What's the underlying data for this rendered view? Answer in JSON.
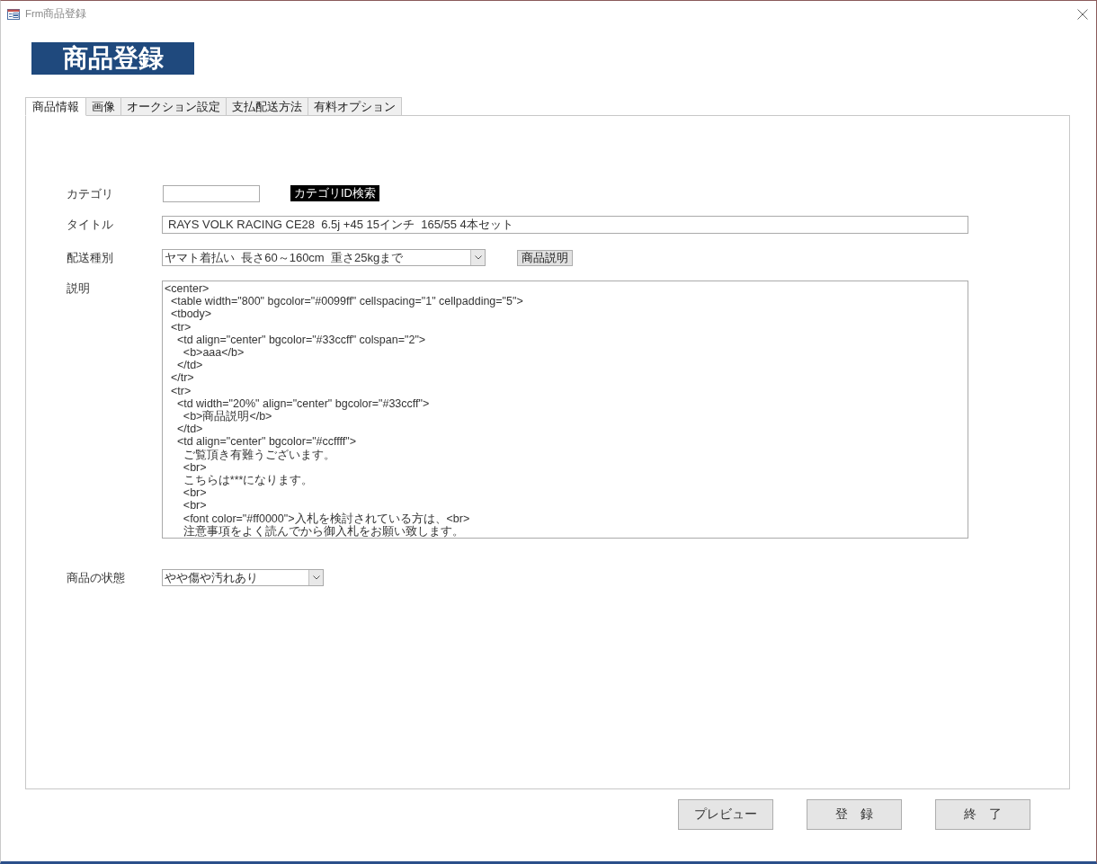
{
  "window": {
    "title": "Frm商品登録"
  },
  "header": {
    "title": "商品登録"
  },
  "tabs": [
    {
      "label": "商品情報",
      "selected": true
    },
    {
      "label": "画像",
      "selected": false
    },
    {
      "label": "オークション設定",
      "selected": false
    },
    {
      "label": "支払配送方法",
      "selected": false
    },
    {
      "label": "有料オプション",
      "selected": false
    }
  ],
  "category": {
    "label": "カテゴリ",
    "search_button": {
      "label": "カテゴリID検索",
      "highlighted": true
    }
  },
  "title": {
    "label": "タイトル",
    "value": "RAYS VOLK RACING CE28  6.5j +45 15インチ  165/55 4本セット"
  },
  "shipping": {
    "label": "配送種別",
    "value": "ヤマト着払い  長さ60～160cm  重さ25kgまで",
    "button": {
      "label": "商品説明"
    }
  },
  "description": {
    "label": "説明",
    "value": "<center>\n  <table width=\"800\" bgcolor=\"#0099ff\" cellspacing=\"1\" cellpadding=\"5\">\n  <tbody>\n  <tr>\n    <td align=\"center\" bgcolor=\"#33ccff\" colspan=\"2\">\n      <b>aaa</b>\n    </td>\n  </tr>\n  <tr>\n    <td width=\"20%\" align=\"center\" bgcolor=\"#33ccff\">\n      <b>商品説明</b>\n    </td>\n    <td align=\"center\" bgcolor=\"#ccffff\">\n      ご覧頂き有難うございます。\n      <br>\n      こちらは***になります。\n      <br>\n      <br>\n      <font color=\"#ff0000\">入札を検討されている方は、<br>\n      注意事項をよく読んでから御入札をお願い致します。"
  },
  "condition": {
    "label": "商品の状態",
    "value": "やや傷や汚れあり"
  },
  "buttons": [
    {
      "label": "プレビュー"
    },
    {
      "label": "登　録"
    },
    {
      "label": "終　了"
    }
  ]
}
